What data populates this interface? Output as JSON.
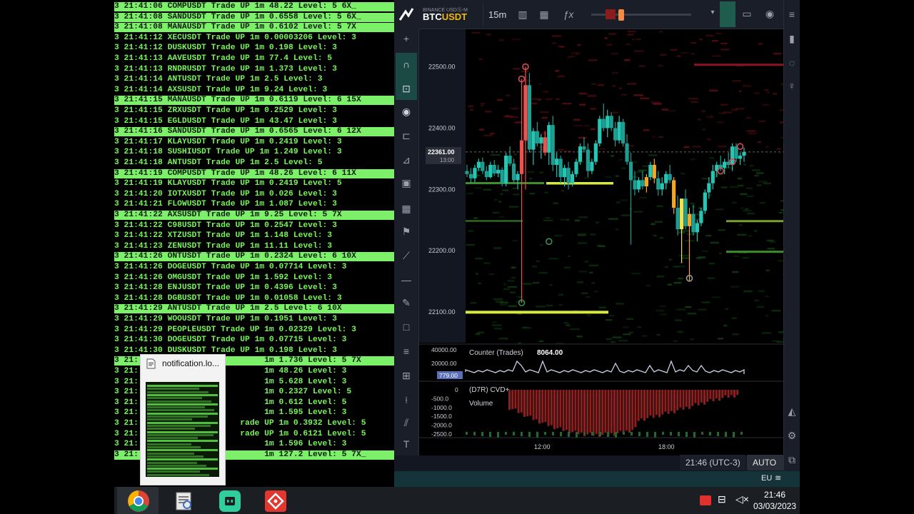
{
  "log": {
    "lines": [
      {
        "text": "3 21:41:06 COMPUSDT Trade UP 1m 48.22 Level: 5 6X_",
        "hl": true
      },
      {
        "text": "3 21:41:08 SANDUSDT Trade UP 1m 0.6558 Level: 5 6X_",
        "hl": true
      },
      {
        "text": "3 21:41:08 MANAUSDT Trade UP 1m 0.6102 Level: 5 7X",
        "hl": true
      },
      {
        "text": "3 21:41:12 XECUSDT Trade UP 1m 0.00003206 Level: 3",
        "hl": false
      },
      {
        "text": "3 21:41:12 DUSKUSDT Trade UP 1m 0.198 Level: 3",
        "hl": false
      },
      {
        "text": "3 21:41:13 AAVEUSDT Trade UP 1m 77.4 Level: 5",
        "hl": false
      },
      {
        "text": "3 21:41:13 RNDRUSDT Trade UP 1m 1.373 Level: 3",
        "hl": false
      },
      {
        "text": "3 21:41:14 ANTUSDT Trade UP 1m 2.5 Level: 3",
        "hl": false
      },
      {
        "text": "3 21:41:14 AXSUSDT Trade UP 1m 9.24 Level: 3",
        "hl": false
      },
      {
        "text": "3 21:41:15 MANAUSDT Trade UP 1m 0.6119 Level: 6 15X",
        "hl": true
      },
      {
        "text": "3 21:41:15 ZRXUSDT Trade UP 1m 0.2529 Level: 3",
        "hl": false
      },
      {
        "text": "3 21:41:15 EGLDUSDT Trade UP 1m 43.47 Level: 3",
        "hl": false
      },
      {
        "text": "3 21:41:16 SANDUSDT Trade UP 1m 0.6565 Level: 6 12X",
        "hl": true
      },
      {
        "text": "3 21:41:17 KLAYUSDT Trade UP 1m 0.2419 Level: 3",
        "hl": false
      },
      {
        "text": "3 21:41:18 SUSHIUSDT Trade UP 1m 1.249 Level: 3",
        "hl": false
      },
      {
        "text": "3 21:41:18 ANTUSDT Trade UP 1m 2.5 Level: 5",
        "hl": false
      },
      {
        "text": "3 21:41:19 COMPUSDT Trade UP 1m 48.26 Level: 6 11X",
        "hl": true
      },
      {
        "text": "3 21:41:19 KLAYUSDT Trade UP 1m 0.2419 Level: 5",
        "hl": false
      },
      {
        "text": "3 21:41:20 IOTXUSDT Trade UP 1m 0.026 Level: 3",
        "hl": false
      },
      {
        "text": "3 21:41:21 FLOWUSDT Trade UP 1m 1.087 Level: 3",
        "hl": false
      },
      {
        "text": "3 21:41:22 AXSUSDT Trade UP 1m 9.25 Level: 5 7X",
        "hl": true
      },
      {
        "text": "3 21:41:22 C98USDT Trade UP 1m 0.2547 Level: 3",
        "hl": false
      },
      {
        "text": "3 21:41:22 XTZUSDT Trade UP 1m 1.148 Level: 3",
        "hl": false
      },
      {
        "text": "3 21:41:23 ZENUSDT Trade UP 1m 11.11 Level: 3",
        "hl": false
      },
      {
        "text": "3 21:41:26 ONTUSDT Trade UP 1m 0.2324 Level: 6 10X",
        "hl": true
      },
      {
        "text": "3 21:41:26 DOGEUSDT Trade UP 1m 0.07714 Level: 3",
        "hl": false
      },
      {
        "text": "3 21:41:26 OMGUSDT Trade UP 1m 1.592 Level: 3",
        "hl": false
      },
      {
        "text": "3 21:41:28 ENJUSDT Trade UP 1m 0.4396 Level: 3",
        "hl": false
      },
      {
        "text": "3 21:41:28 DGBUSDT Trade UP 1m 0.01058 Level: 3",
        "hl": false
      },
      {
        "text": "3 21:41:29 ANTUSDT Trade UP 1m 2.5 Level: 6 10X",
        "hl": true
      },
      {
        "text": "3 21:41:29 WOOUSDT Trade UP 1m 0.1951 Level: 3",
        "hl": false
      },
      {
        "text": "3 21:41:29 PEOPLEUSDT Trade UP 1m 0.02329 Level: 3",
        "hl": false
      },
      {
        "text": "3 21:41:30 DOGEUSDT Trade UP 1m 0.07715 Level: 3",
        "hl": false
      },
      {
        "text": "3 21:41:30 DUSKUSDT Trade UP 1m 0.198 Level: 3",
        "hl": false
      },
      {
        "text": "3 21:                          1m 1.736 Level: 5 7X",
        "hl": true
      },
      {
        "text": "3 21:                          1m 48.26 Level: 3",
        "hl": false
      },
      {
        "text": "3 21:                          1m 5.628 Level: 3",
        "hl": false
      },
      {
        "text": "3 21:                          1m 0.2327 Level: 5",
        "hl": false
      },
      {
        "text": "3 21:                          1m 0.612 Level: 5",
        "hl": false
      },
      {
        "text": "3 21:                          1m 1.595 Level: 3",
        "hl": false
      },
      {
        "text": "3 21:                     rade UP 1m 0.3932 Level: 5",
        "hl": false
      },
      {
        "text": "3 21:                     rade UP 1m 0.6121 Level: 5",
        "hl": false
      },
      {
        "text": "3 21:                          1m 1.596 Level: 3",
        "hl": false
      },
      {
        "text": "3 21:                          1m 127.2 Level: 5 7X_",
        "hl": true
      }
    ]
  },
  "notification": {
    "title": "notification.lo...",
    "icon": "document-icon"
  },
  "chart_app": {
    "exchange": "BINANCE USDⓈ-M",
    "symbol_prefix": "BTC",
    "symbol_suffix": "USDT",
    "interval": "15m",
    "price_ticks": [
      "22500.00",
      "22400.00",
      "22300.00",
      "22200.00",
      "22100.00"
    ],
    "current_price": "22361.00",
    "countdown": "13:00",
    "counter_label": "Counter (Trades)",
    "counter_value": "8064.00",
    "counter_ticks": [
      "40000.00",
      "20000.00"
    ],
    "counter_current": "779.00",
    "cvd_label": "(D7R) CVD+",
    "volume_label": "Volume",
    "cvd_ticks": [
      "0",
      "-500.0",
      "-1000.0",
      "-1500.0",
      "-2000.0",
      "-2500.0"
    ],
    "time_ticks": [
      "12:00",
      "18:00"
    ],
    "clock": "21:46 (UTC-3)",
    "auto_label": "AUTO",
    "region": "EU",
    "colors": {
      "up": "#26c6b5",
      "down": "#ef5350",
      "accent": "#f5a623",
      "wall_yellow": "#d7ea3c",
      "wall_green": "#3e8f2a"
    }
  },
  "taskbar": {
    "apps": [
      "chrome-icon",
      "file-viewer-icon",
      "chat-app-icon",
      "git-app-icon"
    ],
    "time": "21:46",
    "date": "03/03/2023"
  },
  "chart_data": {
    "type": "candlestick",
    "interval": "15m",
    "ylim": [
      22050,
      22560
    ],
    "current_price": 22361,
    "candles": [
      [
        22330,
        22340,
        22320,
        22325
      ],
      [
        22325,
        22335,
        22310,
        22318
      ],
      [
        22318,
        22340,
        22312,
        22335
      ],
      [
        22335,
        22350,
        22330,
        22345
      ],
      [
        22345,
        22352,
        22325,
        22330
      ],
      [
        22330,
        22338,
        22315,
        22320
      ],
      [
        22320,
        22345,
        22318,
        22340
      ],
      [
        22340,
        22348,
        22322,
        22326
      ],
      [
        22326,
        22340,
        22320,
        22332
      ],
      [
        22332,
        22336,
        22305,
        22310
      ],
      [
        22310,
        22360,
        22305,
        22355
      ],
      [
        22355,
        22370,
        22338,
        22342
      ],
      [
        22342,
        22350,
        22310,
        22315
      ],
      [
        22315,
        22330,
        22300,
        22325
      ],
      [
        22325,
        22480,
        22115,
        22380
      ],
      [
        22380,
        22500,
        22300,
        22470
      ],
      [
        22470,
        22490,
        22360,
        22365
      ],
      [
        22365,
        22400,
        22340,
        22395
      ],
      [
        22395,
        22410,
        22370,
        22375
      ],
      [
        22375,
        22390,
        22350,
        22385
      ],
      [
        22385,
        22395,
        22355,
        22360
      ],
      [
        22360,
        22410,
        22340,
        22405
      ],
      [
        22405,
        22420,
        22330,
        22340
      ],
      [
        22340,
        22360,
        22320,
        22350
      ],
      [
        22350,
        22355,
        22310,
        22320
      ],
      [
        22320,
        22340,
        22305,
        22335
      ],
      [
        22335,
        22345,
        22300,
        22310
      ],
      [
        22310,
        22330,
        22305,
        22325
      ],
      [
        22325,
        22350,
        22320,
        22345
      ],
      [
        22345,
        22375,
        22340,
        22370
      ],
      [
        22370,
        22385,
        22360,
        22365
      ],
      [
        22365,
        22375,
        22320,
        22330
      ],
      [
        22330,
        22350,
        22325,
        22345
      ],
      [
        22345,
        22380,
        22340,
        22375
      ],
      [
        22375,
        22420,
        22370,
        22415
      ],
      [
        22415,
        22440,
        22395,
        22400
      ],
      [
        22400,
        22430,
        22385,
        22420
      ],
      [
        22420,
        22425,
        22395,
        22400
      ],
      [
        22400,
        22410,
        22370,
        22380
      ],
      [
        22380,
        22420,
        22375,
        22410
      ],
      [
        22410,
        22415,
        22370,
        22375
      ],
      [
        22375,
        22390,
        22340,
        22345
      ],
      [
        22345,
        22360,
        22210,
        22315
      ],
      [
        22315,
        22330,
        22290,
        22300
      ],
      [
        22300,
        22320,
        22295,
        22315
      ],
      [
        22315,
        22330,
        22300,
        22305
      ],
      [
        22305,
        22325,
        22295,
        22320
      ],
      [
        22320,
        22345,
        22315,
        22340
      ],
      [
        22340,
        22350,
        22310,
        22318
      ],
      [
        22318,
        22330,
        22290,
        22300
      ],
      [
        22300,
        22320,
        22290,
        22310
      ],
      [
        22310,
        22330,
        22300,
        22325
      ],
      [
        22325,
        22340,
        22310,
        22315
      ],
      [
        22315,
        22320,
        22260,
        22270
      ],
      [
        22270,
        22290,
        22225,
        22235
      ],
      [
        22235,
        22260,
        22180,
        22285
      ],
      [
        22285,
        22300,
        22235,
        22240
      ],
      [
        22240,
        22270,
        22150,
        22260
      ],
      [
        22260,
        22275,
        22225,
        22230
      ],
      [
        22230,
        22250,
        22215,
        22245
      ],
      [
        22245,
        22270,
        22240,
        22265
      ],
      [
        22265,
        22300,
        22260,
        22295
      ],
      [
        22295,
        22320,
        22285,
        22310
      ],
      [
        22310,
        22340,
        22300,
        22330
      ],
      [
        22330,
        22345,
        22320,
        22340
      ],
      [
        22340,
        22355,
        22330,
        22335
      ],
      [
        22335,
        22350,
        22325,
        22345
      ],
      [
        22345,
        22360,
        22335,
        22340
      ],
      [
        22340,
        22375,
        22330,
        22370
      ],
      [
        22370,
        22375,
        22345,
        22350
      ],
      [
        22350,
        22360,
        22340,
        22355
      ],
      [
        22355,
        22368,
        22345,
        22361
      ]
    ],
    "highlight": {
      "amber": [
        46,
        75
      ],
      "red": [
        14,
        15,
        20
      ]
    }
  }
}
